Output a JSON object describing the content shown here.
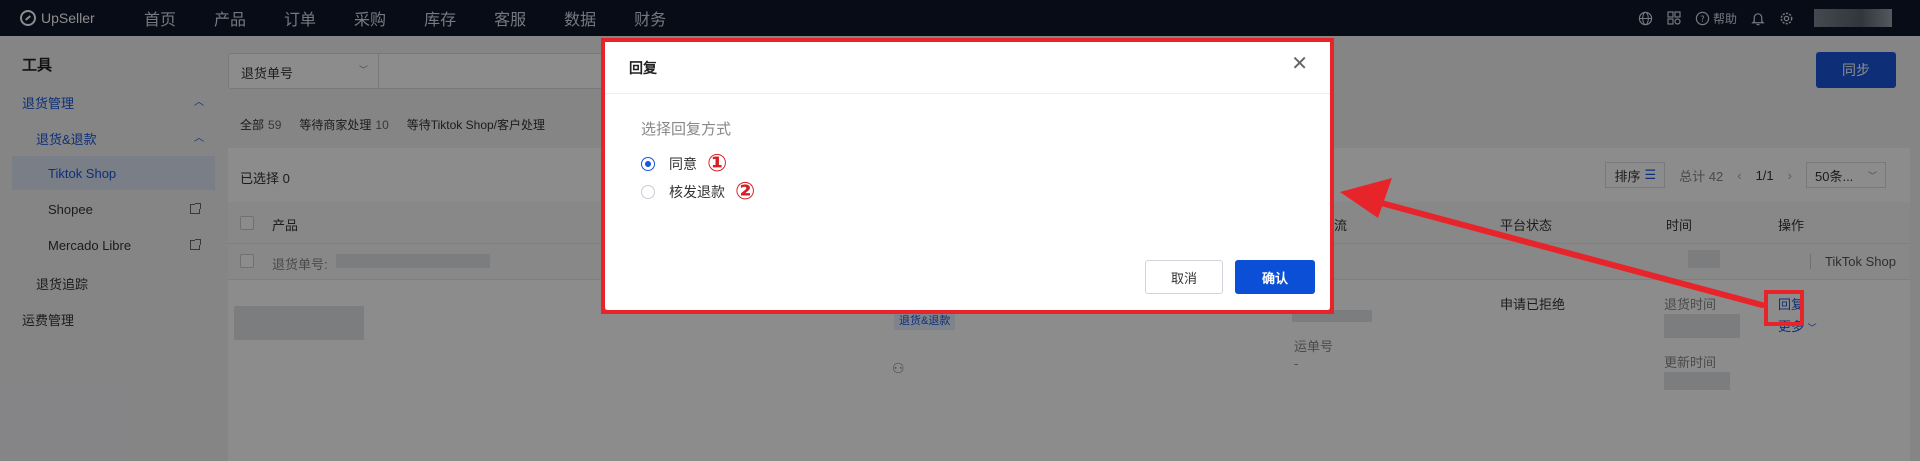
{
  "topnav": {
    "logo_text": "UpSeller",
    "items": [
      "首页",
      "产品",
      "订单",
      "采购",
      "库存",
      "客服",
      "数据",
      "财务"
    ],
    "help_label": "帮助"
  },
  "sidebar": {
    "title": "工具",
    "return_mgmt": "退货管理",
    "returns_refunds": "退货&退款",
    "tiktok": "Tiktok Shop",
    "shopee": "Shopee",
    "mercado": "Mercado Libre",
    "return_tracking": "退货追踪",
    "shipping_mgmt": "运费管理"
  },
  "main": {
    "search_select": "退货单号",
    "sync_label": "同步",
    "tabs": [
      {
        "label": "全部",
        "count": "59"
      },
      {
        "label": "等待商家处理",
        "count": "10"
      },
      {
        "label": "等待Tiktok Shop/客户处理",
        "count": ""
      }
    ],
    "selected_label": "已选择 0",
    "sort_label": "排序",
    "total_label": "总计 42",
    "page_label": "1/1",
    "page_size": "50条...",
    "headers": {
      "product": "产品",
      "logistics": "流",
      "platform_status": "平台状态",
      "time": "时间",
      "action": "操作"
    },
    "row_group": {
      "return_no_label": "退货单号:",
      "store_label": "TikTok Shop"
    },
    "row": {
      "tag": "退货&退款",
      "tracking_label": "运单号",
      "tracking_value": "-",
      "platform_status": "申请已拒绝",
      "return_time_label": "退货时间",
      "update_time_label": "更新时间",
      "reply_link": "回复",
      "more_link": "更多"
    }
  },
  "dialog": {
    "title": "回复",
    "prompt": "选择回复方式",
    "options": [
      {
        "label": "同意",
        "marker": "①",
        "checked": true
      },
      {
        "label": "核发退款",
        "marker": "②",
        "checked": false
      }
    ],
    "cancel_label": "取消",
    "confirm_label": "确认"
  },
  "colors": {
    "accent": "#1a56db",
    "annotation_red": "#e8242b",
    "nav_bg": "#0d1628"
  }
}
